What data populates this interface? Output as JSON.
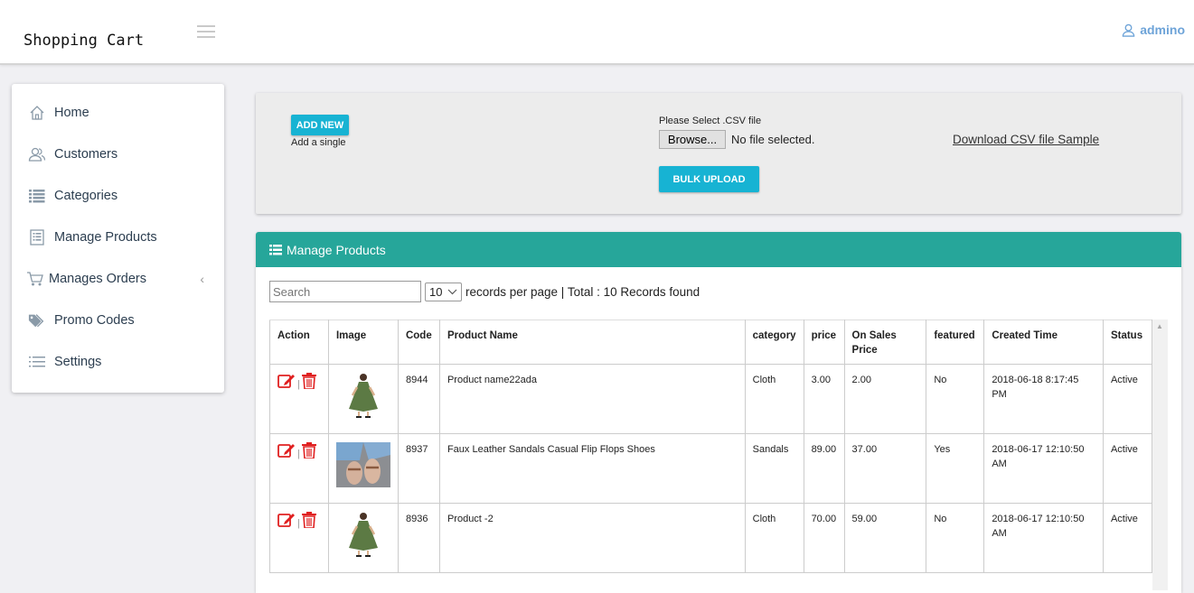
{
  "header": {
    "brand": "Shopping Cart",
    "user": "admino"
  },
  "sidebar": {
    "items": [
      {
        "label": "Home",
        "icon": "home-icon"
      },
      {
        "label": "Customers",
        "icon": "users-icon"
      },
      {
        "label": "Categories",
        "icon": "list-icon"
      },
      {
        "label": "Manage Products",
        "icon": "document-list-icon"
      },
      {
        "label": "Manages Orders",
        "icon": "cart-icon"
      },
      {
        "label": "Promo Codes",
        "icon": "tags-icon"
      },
      {
        "label": "Settings",
        "icon": "settings-list-icon"
      }
    ]
  },
  "upload": {
    "add_new": "ADD NEW",
    "add_single": "Add a single",
    "csv_label": "Please Select .CSV file",
    "browse": "Browse...",
    "no_file": "No file selected.",
    "bulk_upload": "BULK UPLOAD",
    "download_sample": "Download CSV file Sample"
  },
  "products": {
    "title": "Manage Products",
    "search_placeholder": "Search",
    "per_page": "10",
    "records_text": "records per page | Total : 10 Records found",
    "columns": [
      "Action",
      "Image",
      "Code",
      "Product Name",
      "category",
      "price",
      "On Sales Price",
      "featured",
      "Created Time",
      "Status"
    ],
    "rows": [
      {
        "code": "8944",
        "name": "Product name22ada",
        "category": "Cloth",
        "price": "3.00",
        "sale": "2.00",
        "featured": "No",
        "created": "2018-06-18 8:17:45 PM",
        "status": "Active",
        "image": "green-dress"
      },
      {
        "code": "8937",
        "name": "Faux Leather Sandals Casual Flip Flops Shoes",
        "category": "Sandals",
        "price": "89.00",
        "sale": "37.00",
        "featured": "Yes",
        "created": "2018-06-17 12:10:50 AM",
        "status": "Active",
        "image": "sandals"
      },
      {
        "code": "8936",
        "name": "Product -2",
        "category": "Cloth",
        "price": "70.00",
        "sale": "59.00",
        "featured": "No",
        "created": "2018-06-17 12:10:50 AM",
        "status": "Active",
        "image": "green-dress"
      }
    ]
  },
  "colors": {
    "accent": "#17b3d3",
    "panel_header": "#26a69a",
    "action_red": "#e02020",
    "user_link": "#6da3d8"
  }
}
